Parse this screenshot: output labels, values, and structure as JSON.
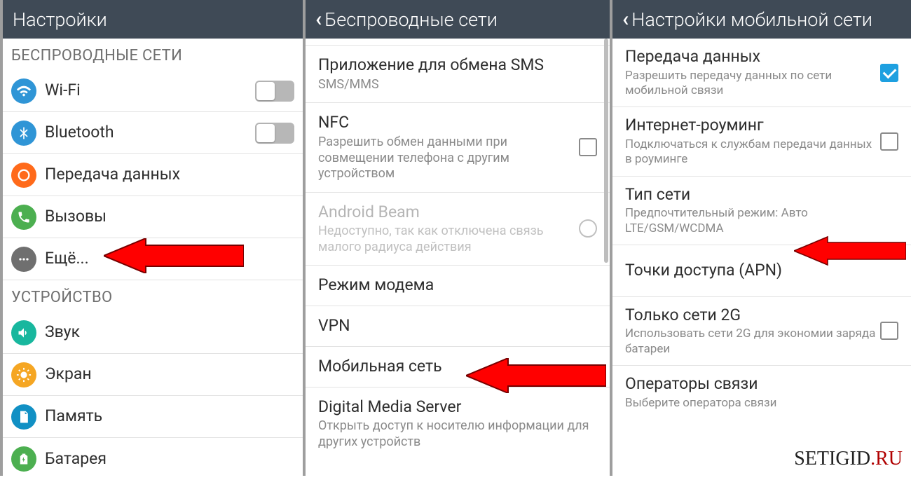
{
  "panelA": {
    "title": "Настройки",
    "section1": "БЕСПРОВОДНЫЕ СЕТИ",
    "wifi": "Wi-Fi",
    "bluetooth": "Bluetooth",
    "data": "Передача данных",
    "calls": "Вызовы",
    "more": "Ещё...",
    "section2": "УСТРОЙСТВО",
    "sound": "Звук",
    "display": "Экран",
    "storage": "Память",
    "battery": "Батарея"
  },
  "panelB": {
    "title": "Беспроводные сети",
    "sms": {
      "title": "Приложение для обмена SMS",
      "sub": "SMS/MMS"
    },
    "nfc": {
      "title": "NFC",
      "sub": "Разрешить обмен данными при совмещении телефона с другим устройством"
    },
    "beam": {
      "title": "Android Beam",
      "sub": "Недоступно, так как отключена связь малого радиуса действия"
    },
    "tether": "Режим модема",
    "vpn": "VPN",
    "mobile": "Мобильная сеть",
    "dms": {
      "title": "Digital Media Server",
      "sub": "Открыть доступ к носителю информации для других устройств"
    }
  },
  "panelC": {
    "title": "Настройки мобильной сети",
    "data": {
      "title": "Передача данных",
      "sub": "Разрешить передачу данных по сети мобильной связи"
    },
    "roaming": {
      "title": "Интернет-роуминг",
      "sub": "Подключаться к службам передачи данных в роуминге"
    },
    "type": {
      "title": "Тип сети",
      "sub": "Предпочтительный режим: Авто LTE/GSM/WCDMA"
    },
    "apn": "Точки доступа (APN)",
    "only2g": {
      "title": "Только сети 2G",
      "sub": "Использовать сети 2G для экономии заряда батареи"
    },
    "operators": {
      "title": "Операторы связи",
      "sub": "Выберите оператора связи"
    }
  },
  "watermark": {
    "a": "SETIGID",
    "b": ".RU"
  },
  "icons": {
    "wifi": {
      "bg": "#2f95d6"
    },
    "bluetooth": {
      "bg": "#2f95d6"
    },
    "data": {
      "bg": "#ff6a1a"
    },
    "calls": {
      "bg": "#4caf50"
    },
    "more": {
      "bg": "#6f6f6f"
    },
    "sound": {
      "bg": "#18b79e"
    },
    "display": {
      "bg": "#f5a623"
    },
    "storage": {
      "bg": "#1190c4"
    },
    "battery": {
      "bg": "#4caf50"
    }
  }
}
